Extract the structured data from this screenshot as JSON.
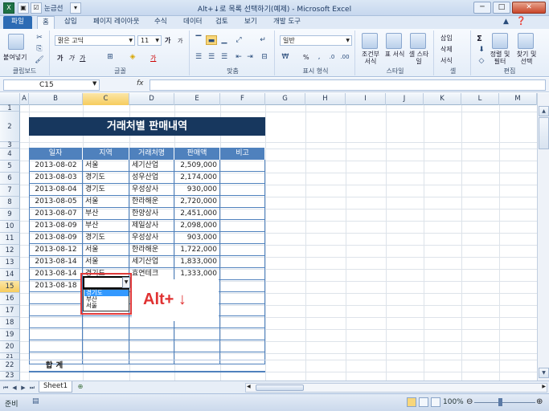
{
  "window": {
    "title": "Alt+↓로 목록 선택하기(예제) - Microsoft Excel",
    "qat_extra": "눈금선",
    "controls": [
      "─",
      "□",
      "✕"
    ]
  },
  "tabs": [
    "파일",
    "홈",
    "삽입",
    "페이지 레이아웃",
    "수식",
    "데이터",
    "검토",
    "보기",
    "개발 도구"
  ],
  "ribbon": {
    "clipboard": {
      "paste": "붙여넣기",
      "label": "클립보드"
    },
    "font": {
      "name": "맑은 고딕",
      "size": "11",
      "bold": "가",
      "italic": "가",
      "underline": "가",
      "grow": "가",
      "shrink": "가",
      "color_letter": "가",
      "label": "글꼴"
    },
    "alignment": {
      "label": "맞춤"
    },
    "number": {
      "format": "일반",
      "percent": "%",
      "label": "표시 형식"
    },
    "styles": {
      "conditional": "조건부 서식",
      "table": "표 서식",
      "cell": "셀 스타일",
      "label": "스타일"
    },
    "cells": {
      "insert": "삽입",
      "delete": "삭제",
      "format": "서식",
      "label": "셀"
    },
    "editing": {
      "sum": "Σ",
      "sort": "정렬 및 필터",
      "find": "찾기 및 선택",
      "label": "편집"
    }
  },
  "formula_bar": {
    "name_box": "C15",
    "fx": "fx",
    "value": ""
  },
  "columns": [
    "A",
    "B",
    "C",
    "D",
    "E",
    "F",
    "G",
    "H",
    "I",
    "J",
    "K",
    "L",
    "M"
  ],
  "rows": [
    "1",
    "2",
    "3",
    "4",
    "5",
    "6",
    "7",
    "8",
    "9",
    "10",
    "11",
    "12",
    "13",
    "14",
    "15",
    "16",
    "17",
    "18",
    "19",
    "20",
    "21",
    "22",
    "23"
  ],
  "sheet": {
    "title": "거래처별 판매내역",
    "headers": [
      "일자",
      "지역",
      "거래처명",
      "판매액",
      "비고"
    ],
    "data": [
      [
        "2013-08-02",
        "서울",
        "세기산업",
        "2,509,000",
        ""
      ],
      [
        "2013-08-03",
        "경기도",
        "성우산업",
        "2,174,000",
        ""
      ],
      [
        "2013-08-04",
        "경기도",
        "우성상사",
        "930,000",
        ""
      ],
      [
        "2013-08-05",
        "서울",
        "한라해운",
        "2,720,000",
        ""
      ],
      [
        "2013-08-07",
        "부산",
        "한양상사",
        "2,451,000",
        ""
      ],
      [
        "2013-08-09",
        "부산",
        "제일상사",
        "2,098,000",
        ""
      ],
      [
        "2013-08-09",
        "경기도",
        "우성상사",
        "903,000",
        ""
      ],
      [
        "2013-08-12",
        "서울",
        "한라해운",
        "1,722,000",
        ""
      ],
      [
        "2013-08-14",
        "서울",
        "세기산업",
        "1,833,000",
        ""
      ],
      [
        "2013-08-14",
        "경기도",
        "효연테크",
        "1,333,000",
        ""
      ],
      [
        "2013-08-18",
        "",
        "",
        "",
        ""
      ]
    ],
    "total_label": "합계"
  },
  "dropdown": {
    "options": [
      "경기도",
      "부산",
      "서울"
    ],
    "selected": "경기도"
  },
  "callout": "Alt+ ↓",
  "sheet_tabs": [
    "Sheet1"
  ],
  "status": {
    "mode": "준비",
    "zoom": "100%"
  }
}
